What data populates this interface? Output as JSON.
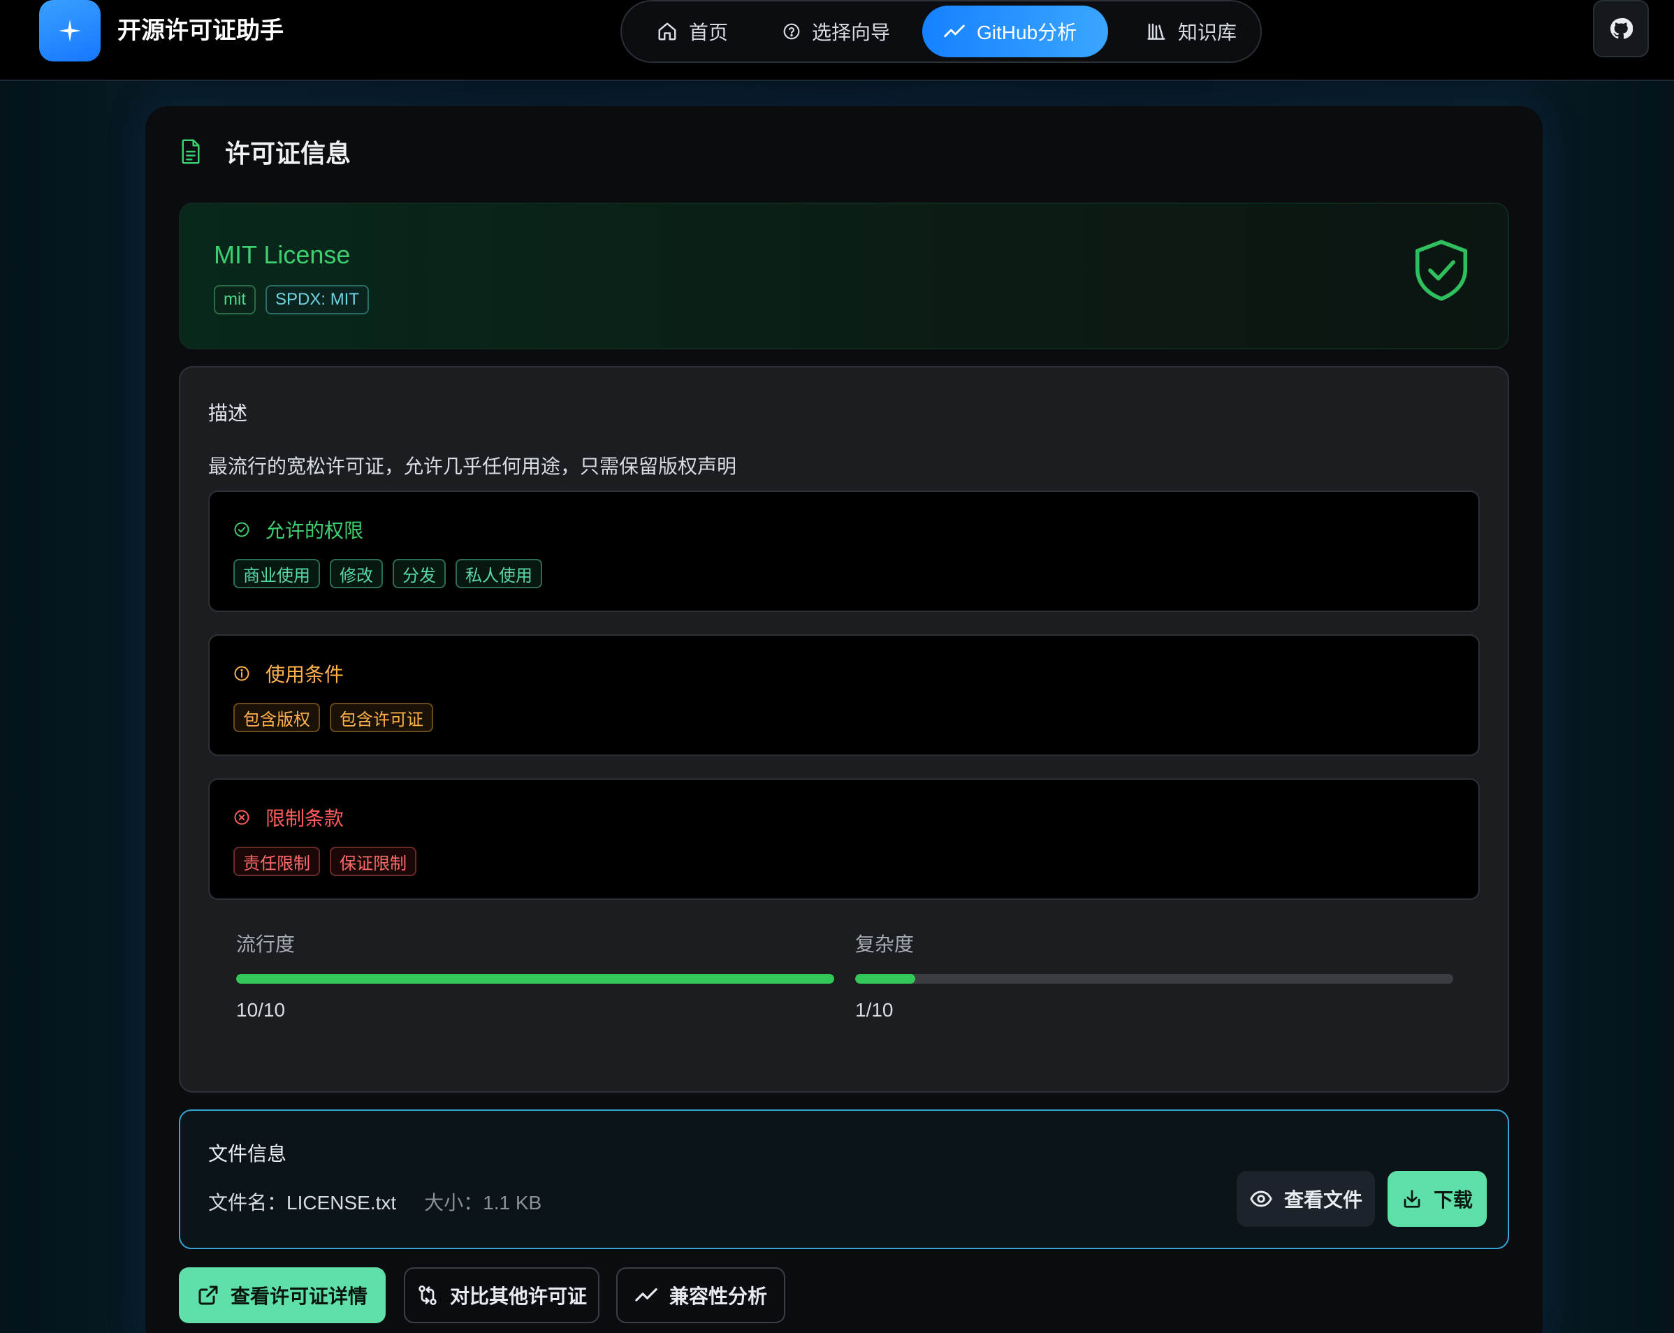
{
  "app": {
    "title": "开源许可证助手"
  },
  "nav": [
    {
      "label": "首页",
      "icon": "home-icon",
      "active": false
    },
    {
      "label": "选择向导",
      "icon": "help-circle-icon",
      "active": false
    },
    {
      "label": "GitHub分析",
      "icon": "trend-icon",
      "active": true
    },
    {
      "label": "知识库",
      "icon": "library-icon",
      "active": false
    }
  ],
  "card": {
    "title": "许可证信息"
  },
  "license": {
    "name": "MIT License",
    "tags": [
      "mit",
      "SPDX: MIT"
    ]
  },
  "description": {
    "label": "描述",
    "text": "最流行的宽松许可证，允许几乎任何用途，只需保留版权声明"
  },
  "permissions": {
    "title": "允许的权限",
    "items": [
      "商业使用",
      "修改",
      "分发",
      "私人使用"
    ]
  },
  "conditions": {
    "title": "使用条件",
    "items": [
      "包含版权",
      "包含许可证"
    ]
  },
  "limitations": {
    "title": "限制条款",
    "items": [
      "责任限制",
      "保证限制"
    ]
  },
  "metrics": {
    "popularity": {
      "label": "流行度",
      "value": 10,
      "max": 10,
      "display": "10/10"
    },
    "complexity": {
      "label": "复杂度",
      "value": 1,
      "max": 10,
      "display": "1/10"
    }
  },
  "file": {
    "title": "文件信息",
    "name_text": "文件名：LICENSE.txt",
    "size_text": "大小：1.1 KB",
    "view_label": "查看文件",
    "download_label": "下载"
  },
  "actions": {
    "details_label": "查看许可证详情",
    "compare_label": "对比其他许可证",
    "compat_label": "兼容性分析"
  },
  "colors": {
    "accent_blue": "#1681ff",
    "success_green": "#34c759",
    "condition_orange": "#ffb14d",
    "limit_red": "#ff6b6b",
    "mint_button": "#5fe0a8"
  }
}
